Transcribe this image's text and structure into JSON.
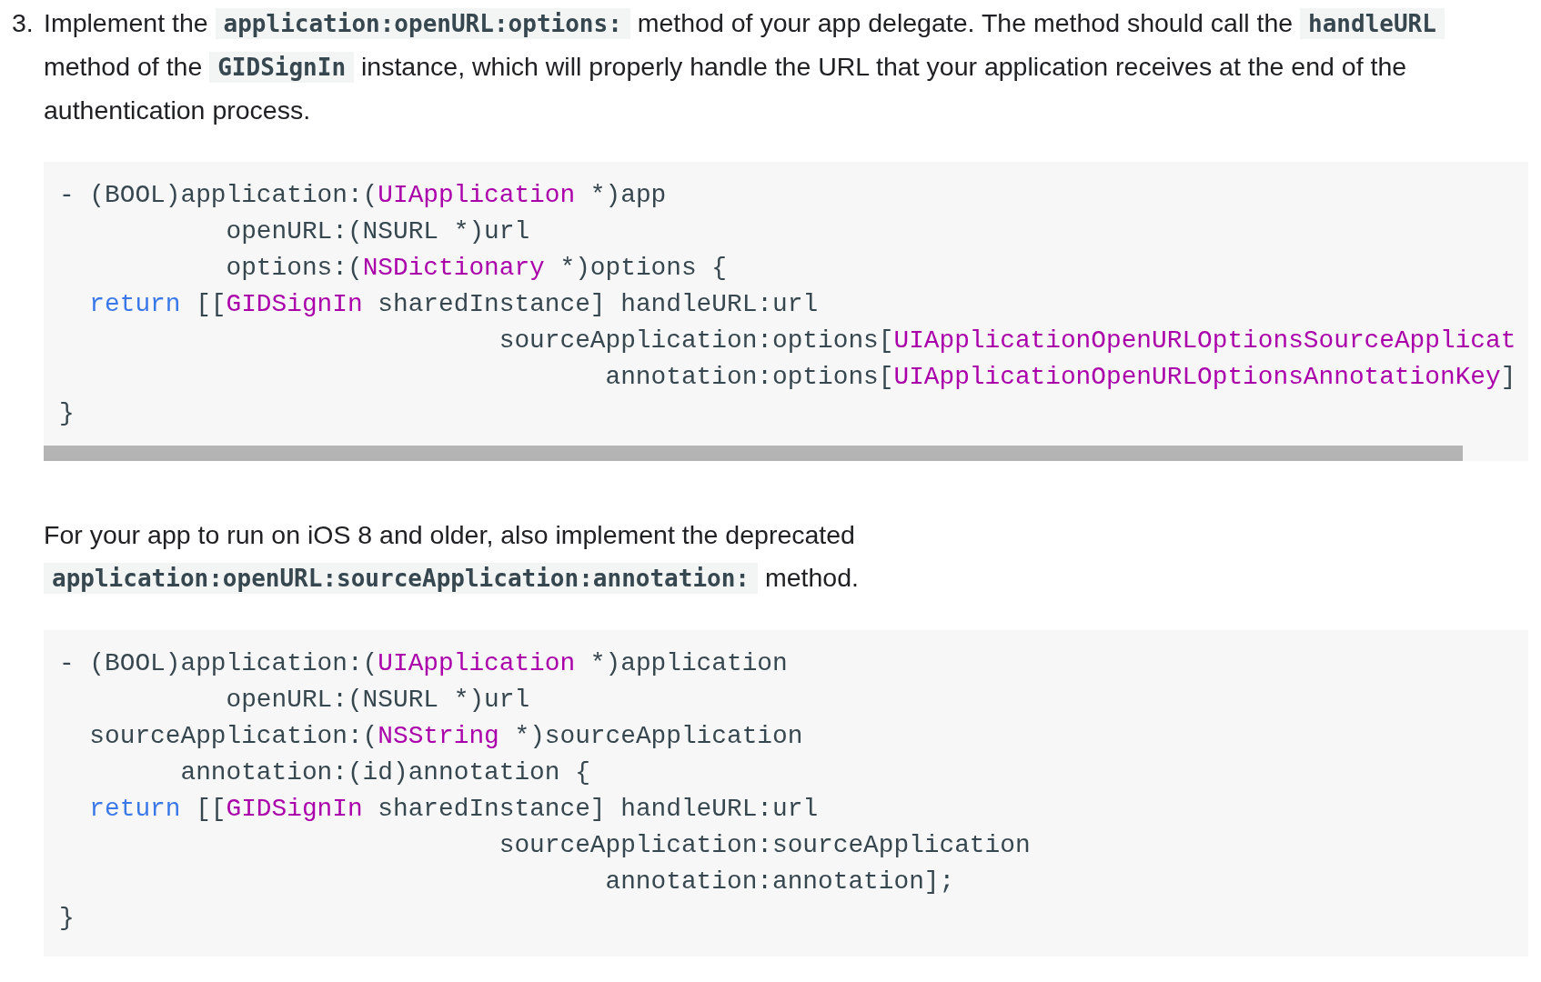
{
  "steps": [
    {
      "number": "3.",
      "runs": [
        {
          "kind": "text",
          "text": "Implement the "
        },
        {
          "kind": "code",
          "text": "application:openURL:options:"
        },
        {
          "kind": "text",
          "text": " method of your app delegate. The method should call the "
        },
        {
          "kind": "code",
          "text": "handleURL"
        },
        {
          "kind": "text",
          "text": " method of the "
        },
        {
          "kind": "code",
          "text": "GIDSignIn"
        },
        {
          "kind": "text",
          "text": " instance, which will properly handle the URL that your application receives at the end of the authentication process."
        }
      ],
      "code": [
        [
          {
            "kind": "plain",
            "text": "- (BOOL)application:("
          },
          {
            "kind": "type",
            "text": "UIApplication"
          },
          {
            "kind": "plain",
            "text": " *)app"
          }
        ],
        [
          {
            "kind": "plain",
            "text": "           openURL:(NSURL *)url"
          }
        ],
        [
          {
            "kind": "plain",
            "text": "           options:("
          },
          {
            "kind": "type",
            "text": "NSDictionary"
          },
          {
            "kind": "plain",
            "text": " *)options {"
          }
        ],
        [
          {
            "kind": "keyword",
            "text": "  return"
          },
          {
            "kind": "plain",
            "text": " [["
          },
          {
            "kind": "type",
            "text": "GIDSignIn"
          },
          {
            "kind": "plain",
            "text": " sharedInstance] handleURL:url"
          }
        ],
        [
          {
            "kind": "plain",
            "text": "                             sourceApplication:options["
          },
          {
            "kind": "type",
            "text": "UIApplicationOpenURLOptionsSourceApplicat"
          }
        ],
        [
          {
            "kind": "plain",
            "text": "                                    annotation:options["
          },
          {
            "kind": "type",
            "text": "UIApplicationOpenURLOptionsAnnotationKey"
          },
          {
            "kind": "plain",
            "text": "]"
          }
        ],
        [
          {
            "kind": "plain",
            "text": "}"
          }
        ]
      ],
      "scrollbar": true
    },
    {
      "runs": [
        {
          "kind": "text",
          "text": "For your app to run on iOS 8 and older, also implement the deprecated "
        },
        {
          "kind": "code",
          "text": "application:openURL:sourceApplication:annotation:"
        },
        {
          "kind": "text",
          "text": " method."
        }
      ],
      "code": [
        [
          {
            "kind": "plain",
            "text": "- (BOOL)application:("
          },
          {
            "kind": "type",
            "text": "UIApplication"
          },
          {
            "kind": "plain",
            "text": " *)application"
          }
        ],
        [
          {
            "kind": "plain",
            "text": "           openURL:(NSURL *)url"
          }
        ],
        [
          {
            "kind": "plain",
            "text": "  sourceApplication:("
          },
          {
            "kind": "type",
            "text": "NSString"
          },
          {
            "kind": "plain",
            "text": " *)sourceApplication"
          }
        ],
        [
          {
            "kind": "plain",
            "text": "        annotation:(id)annotation {"
          }
        ],
        [
          {
            "kind": "keyword",
            "text": "  return"
          },
          {
            "kind": "plain",
            "text": " [["
          },
          {
            "kind": "type",
            "text": "GIDSignIn"
          },
          {
            "kind": "plain",
            "text": " sharedInstance] handleURL:url"
          }
        ],
        [
          {
            "kind": "plain",
            "text": "                             sourceApplication:sourceApplication"
          }
        ],
        [
          {
            "kind": "plain",
            "text": "                                    annotation:annotation];"
          }
        ],
        [
          {
            "kind": "plain",
            "text": "}"
          }
        ]
      ],
      "scrollbar": false
    }
  ]
}
